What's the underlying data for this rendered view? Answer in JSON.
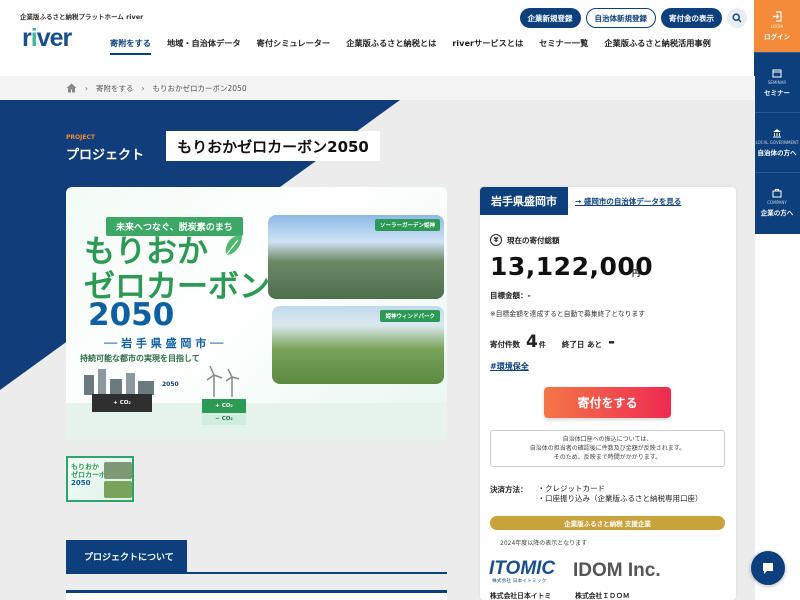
{
  "header": {
    "tagline": "企業版ふるさと納税プラットホーム river",
    "logo_r": "r",
    "logo_i": "i",
    "logo_rest": "ver",
    "buttons": {
      "company_register": "企業新規登録",
      "gov_register": "自治体新規登録",
      "donation_view": "寄付金の表示"
    },
    "nav": [
      "寄附をする",
      "地域・自治体データ",
      "寄付シミュレーター",
      "企業版ふるさと納税とは",
      "riverサービスとは",
      "セミナー一覧",
      "企業版ふるさと納税活用事例"
    ]
  },
  "rail": {
    "login_small": "LOGIN",
    "login": "ログイン",
    "seminar_small": "SEMINAR",
    "seminar": "セミナー",
    "gov_small": "LOCAL GOVERNMENT",
    "gov": "自治体の方へ",
    "company_small": "COMPANY",
    "company": "企業の方へ"
  },
  "breadcrumb": [
    "寄附をする",
    "もりおかゼロカーボン2050"
  ],
  "project": {
    "label_en": "PROJECT",
    "label": "プロジェクト",
    "name": "もりおかゼロカーボン2050"
  },
  "hero": {
    "subtitle": "未来へつなぐ、脱炭素のまち",
    "title_line1": "もりおか",
    "title_line2": "ゼロカーボン",
    "title_year": "2050",
    "city": "── 岩 手 県 盛 岡 市 ──",
    "desc": "持続可能な都市の実現を目指して",
    "photo1_tag": "ソーラーガーデン姫神",
    "photo2_tag": "姫神ウィンドパーク",
    "co2_plus": "+ CO₂",
    "co2_plus2": "+ CO₂",
    "co2_minus": "− CO₂",
    "year_arrow": "2050"
  },
  "about_button": "プロジェクトについて",
  "donation_card": {
    "prefecture": "岩手県盛岡市",
    "pref_link": "→ 盛岡市の自治体データを見る",
    "total_label": "現在の寄付総額",
    "yen_symbol": "¥",
    "amount": "13,122,000",
    "yen": "円",
    "goal_label": "目標金額：-",
    "note": "※目標金額を達成すると自動で募集終了となります",
    "count_label": "寄付件数",
    "count": "4",
    "count_unit": "件",
    "end_label": "終了日 あと",
    "end_value": "-",
    "hashtag": "#環境保全",
    "donate_button": "寄付をする",
    "info_line1": "自治体口座への振込については、",
    "info_line2": "自治体の担当者の確認後に件数及び金額が反映されます。",
    "info_line3": "そのため、反映まで時間がかかります。",
    "pay_label": "決済方法：",
    "pay_methods": [
      "・クレジットカード",
      "・口座振り込み（企業版ふるさと納税専用口座）"
    ],
    "support_label": "企業版ふるさと納税 支援企業",
    "since_note": "2024年度以降の表示となります",
    "companies": [
      "株式会社日本イトミ",
      "株式会社ＩＤＯＭ"
    ],
    "logo_itomic": "ITOMIC",
    "logo_itomic_sub": "株式会社 日本イトミック",
    "logo_idom": "IDOM Inc."
  },
  "colors": {
    "navy": "#0d3f7d",
    "orange": "#f28c3a",
    "green": "#2c9a55",
    "gold": "#c9a23c",
    "donate_gradient_start": "#f47647",
    "donate_gradient_end": "#ee2a52"
  }
}
